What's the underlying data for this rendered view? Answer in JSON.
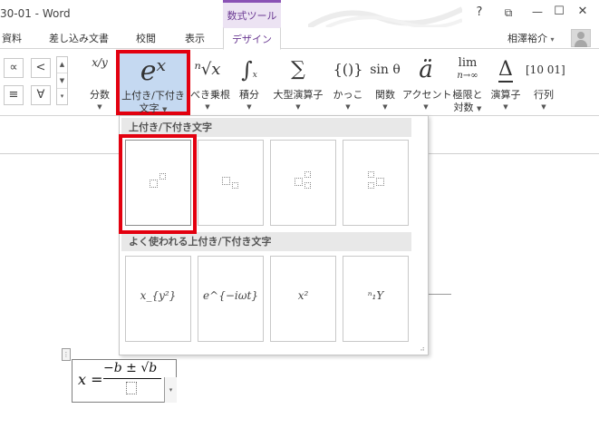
{
  "window": {
    "title": "30-01 - Word",
    "context_tab_label": "数式ツール",
    "help_button": "?",
    "restore_button": "⧉",
    "minimize_button": "—",
    "maximize_button": "☐",
    "close_button": "✕"
  },
  "tabs": {
    "items": [
      "資料",
      "差し込み文書",
      "校閲",
      "表示"
    ],
    "active": "デザイン",
    "user_name": "相澤裕介",
    "user_caret": "▾"
  },
  "symbols": {
    "row1": [
      "∝",
      "<"
    ],
    "row2": [
      "≡",
      "∀"
    ]
  },
  "ribbon": {
    "fraction": {
      "icon": "x/y",
      "label": "分数"
    },
    "script": {
      "icon": "eˣ",
      "label_line1": "上付き/下付き",
      "label_line2": "文字"
    },
    "radical": {
      "icon": "ⁿ√x",
      "label": "べき乗根"
    },
    "integral": {
      "icon": "∫",
      "label": "積分"
    },
    "large_operator": {
      "icon": "∑",
      "label": "大型演算子"
    },
    "bracket": {
      "icon": "{()}",
      "label": "かっこ"
    },
    "function": {
      "icon": "sin θ",
      "label": "関数"
    },
    "accent": {
      "icon": "ä",
      "label": "アクセント"
    },
    "limit": {
      "icon": "lim",
      "icon_sub": "n→∞",
      "label_line1": "極限と",
      "label_line2": "対数"
    },
    "operator": {
      "icon": "Δ",
      "label": "演算子"
    },
    "matrix": {
      "icon": "[10 01]",
      "label": "行列"
    }
  },
  "gallery": {
    "section1_title": "上付き/下付き文字",
    "section2_title": "よく使われる上付き/下付き文字",
    "common_formulas": [
      "x_{y²}",
      "e^{−iωt}",
      "x²",
      "ⁿ₁Y"
    ],
    "resize_grip": "⠴"
  },
  "equation": {
    "lhs": "x =",
    "numerator": "−b ± √b",
    "grip": "⋮",
    "dropdown": "▾"
  },
  "colors": {
    "highlight": "#e3000f",
    "selected_button_bg": "#c5d9f1",
    "context_accent": "#8a52b5"
  }
}
